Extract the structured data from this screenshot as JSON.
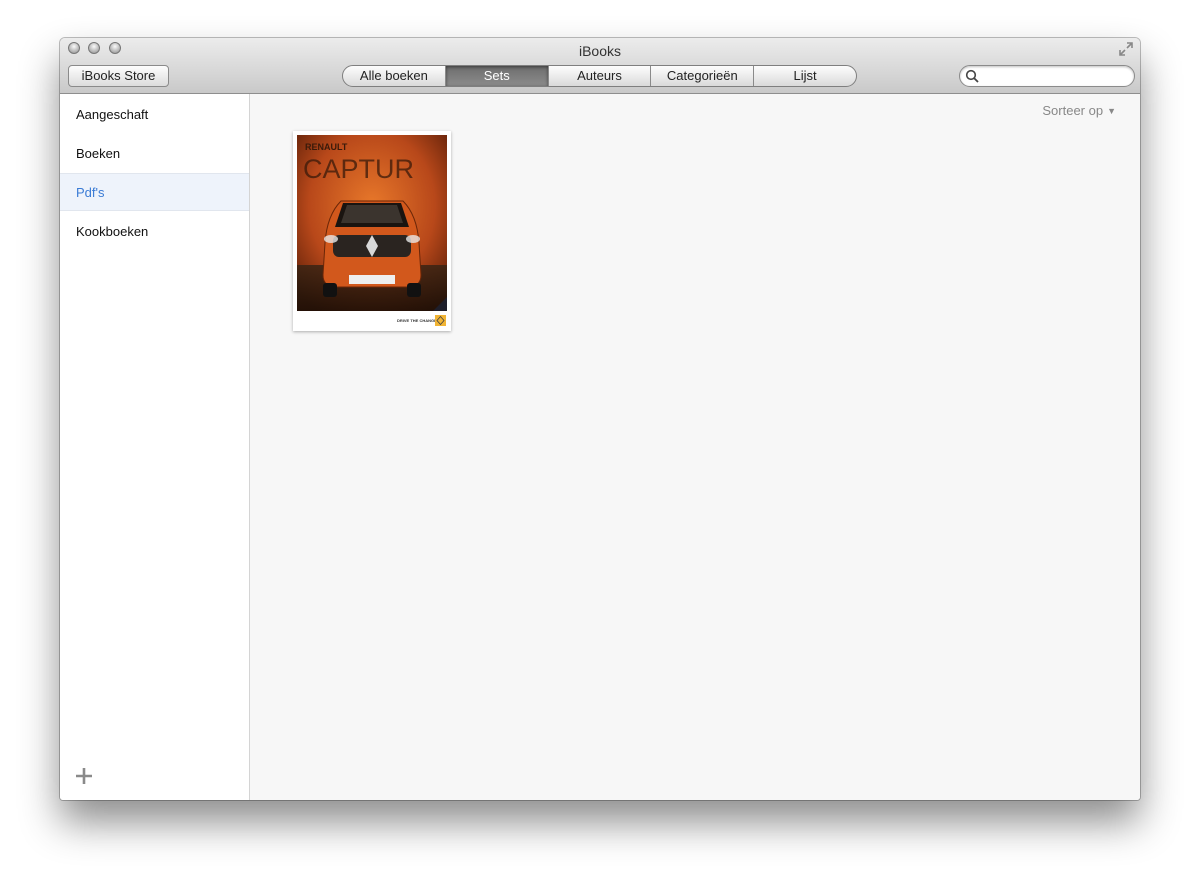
{
  "window": {
    "title": "iBooks"
  },
  "toolbar": {
    "store_label": "iBooks Store",
    "tabs": [
      "Alle boeken",
      "Sets",
      "Auteurs",
      "Categorieën",
      "Lijst"
    ],
    "active_tab": "Sets",
    "search": {
      "value": "",
      "placeholder": ""
    }
  },
  "sidebar": {
    "items": [
      {
        "label": "Aangeschaft",
        "selected": false
      },
      {
        "label": "Boeken",
        "selected": false
      },
      {
        "label": "Pdf's",
        "selected": true
      },
      {
        "label": "Kookboeken",
        "selected": false
      }
    ],
    "add_icon": "plus-icon"
  },
  "main": {
    "sort_label": "Sorteer op",
    "books": [
      {
        "cover_brand": "RENAULT",
        "cover_model": "CAPTUR",
        "cover_tagline": "DRIVE THE CHANGE",
        "cover_color": "#c8501a"
      }
    ]
  },
  "colors": {
    "accent": "#3a7bd5",
    "selection_bg": "#eef3fb"
  }
}
